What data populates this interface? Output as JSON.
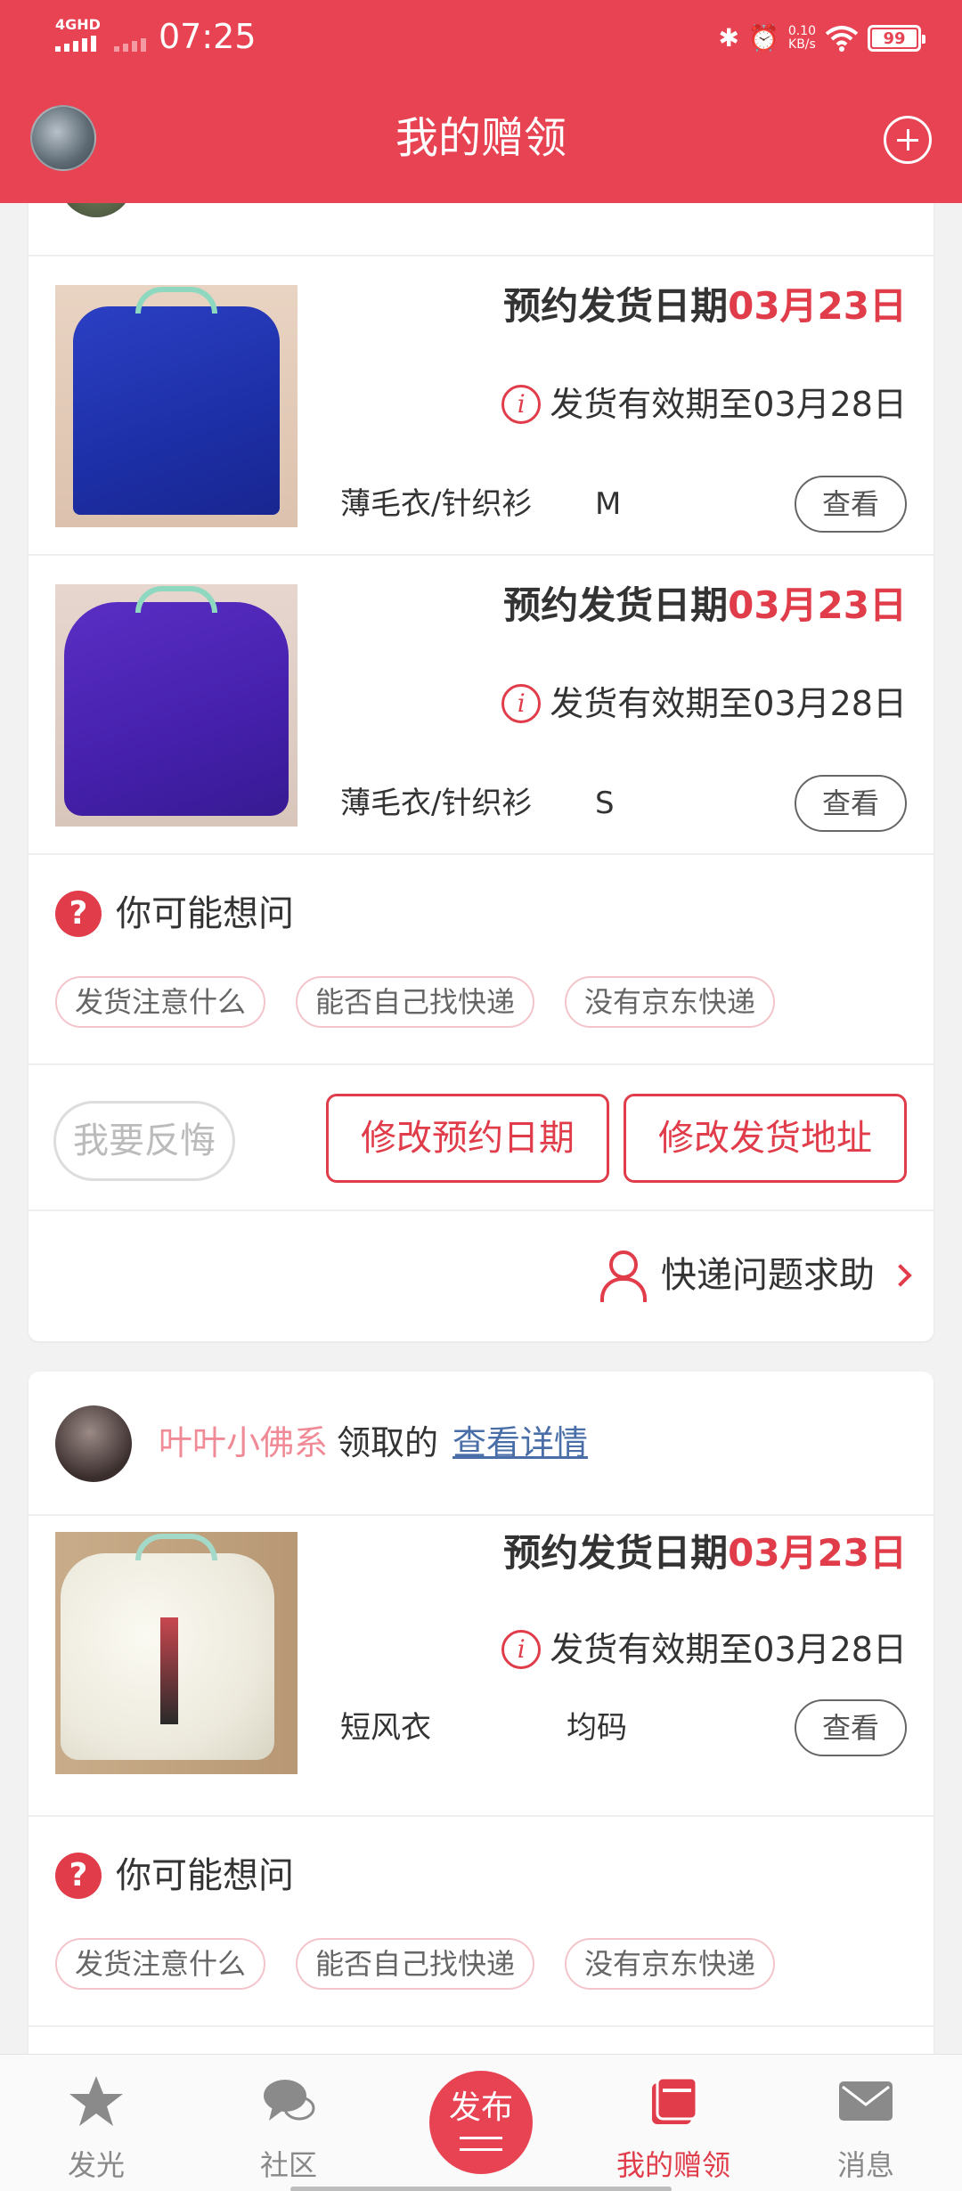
{
  "status_bar": {
    "network": "4GHD",
    "time": "07:25",
    "speed_value": "0.10",
    "speed_unit": "KB/s",
    "battery": "99"
  },
  "header": {
    "title": "我的赠领"
  },
  "items_card1": [
    {
      "schedule_label": "预约发货日期",
      "schedule_date": "03月23日",
      "validity": "发货有效期至03月28日",
      "category": "薄毛衣/针织衫",
      "size": "M",
      "view_label": "查看",
      "image_icon": "blue-sweater"
    },
    {
      "schedule_label": "预约发货日期",
      "schedule_date": "03月23日",
      "validity": "发货有效期至03月28日",
      "category": "薄毛衣/针织衫",
      "size": "S",
      "view_label": "查看",
      "image_icon": "purple-sweater"
    }
  ],
  "faq_card1": {
    "title": "你可能想问",
    "chips": [
      "发货注意什么",
      "能否自己找快递",
      "没有京东快递"
    ]
  },
  "actions": {
    "regret": "我要反悔",
    "change_date": "修改预约日期",
    "change_address": "修改发货地址"
  },
  "help": {
    "label": "快递问题求助"
  },
  "card2": {
    "claimer_name": "叶叶小佛系",
    "claimer_verb": "领取的",
    "details_link": "查看详情",
    "item": {
      "schedule_label": "预约发货日期",
      "schedule_date": "03月23日",
      "validity": "发货有效期至03月28日",
      "category": "短风衣",
      "size": "均码",
      "view_label": "查看",
      "image_icon": "white-fur-jacket"
    },
    "faq": {
      "title": "你可能想问",
      "chips": [
        "发货注意什么",
        "能否自己找快递",
        "没有京东快递"
      ]
    }
  },
  "bottom_nav": {
    "items": [
      {
        "label": "发光",
        "icon": "star-icon"
      },
      {
        "label": "社区",
        "icon": "chat-icon"
      },
      {
        "label": "发布",
        "icon": "publish-icon"
      },
      {
        "label": "我的赠领",
        "icon": "gift-box-icon",
        "active": true
      },
      {
        "label": "消息",
        "icon": "mail-icon"
      }
    ]
  },
  "colors": {
    "brand": "#e84352",
    "accent_text": "#e03c4a",
    "link": "#4a6ea8",
    "claimer_name": "#f08a96"
  }
}
